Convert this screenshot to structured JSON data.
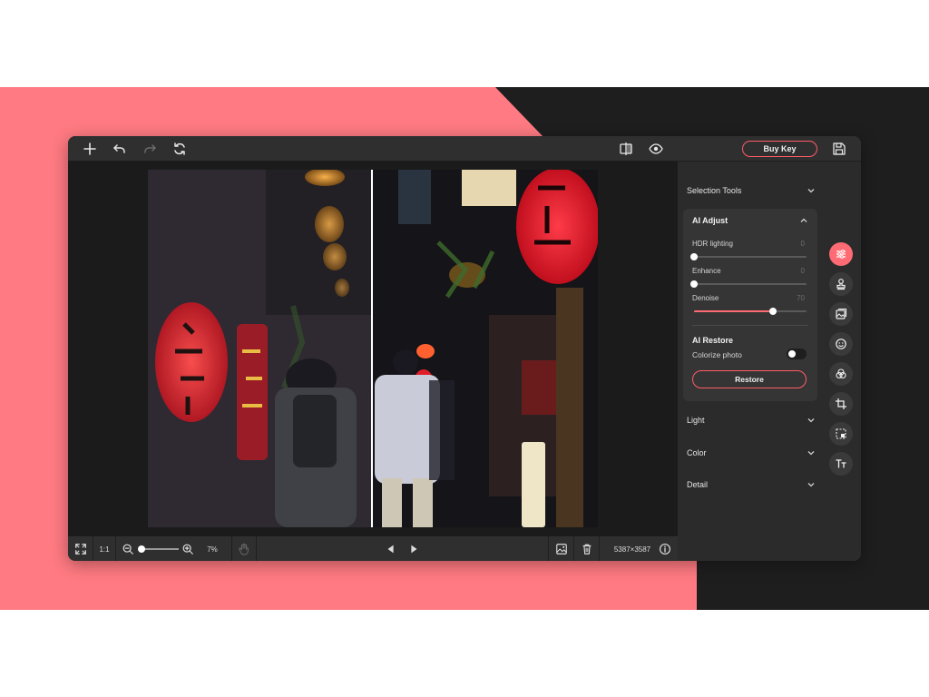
{
  "toolbar": {
    "buy_key_label": "Buy Key",
    "icons": [
      "add-icon",
      "undo-icon",
      "redo-icon",
      "reset-icon",
      "compare-split-icon",
      "preview-eye-icon",
      "save-icon"
    ]
  },
  "bottom_bar": {
    "fit_icon": "fit-screen-icon",
    "ratio_label": "1:1",
    "zoom_value": "7%",
    "zoom_level": 0.07,
    "image_size": "5387×3587",
    "icons": [
      "zoom-out-icon",
      "zoom-in-icon",
      "hand-icon",
      "prev-image-icon",
      "next-image-icon",
      "image-icon",
      "trash-icon",
      "info-icon"
    ]
  },
  "panel": {
    "selection_tools": "Selection Tools",
    "ai_adjust": {
      "title": "AI Adjust",
      "sliders": [
        {
          "label": "HDR lighting",
          "value": "0",
          "level": 0
        },
        {
          "label": "Enhance",
          "value": "0",
          "level": 0
        },
        {
          "label": "Denoise",
          "value": "70",
          "level": 0.7
        }
      ]
    },
    "ai_restore": {
      "title": "AI Restore",
      "colorize_label": "Colorize photo",
      "colorize_on": false,
      "restore_label": "Restore"
    },
    "sections": [
      "Light",
      "Color",
      "Detail"
    ]
  },
  "tool_rail": [
    "adjust-sliders-icon",
    "stamp-icon",
    "image-replace-icon",
    "face-icon",
    "blend-circles-icon",
    "crop-icon",
    "select-area-icon",
    "text-icon"
  ],
  "colors": {
    "accent": "#ff6b74",
    "brand_pink": "#ff7a82",
    "dark_bg": "#1e1e1e",
    "panel_bg": "#2b2b2b"
  }
}
